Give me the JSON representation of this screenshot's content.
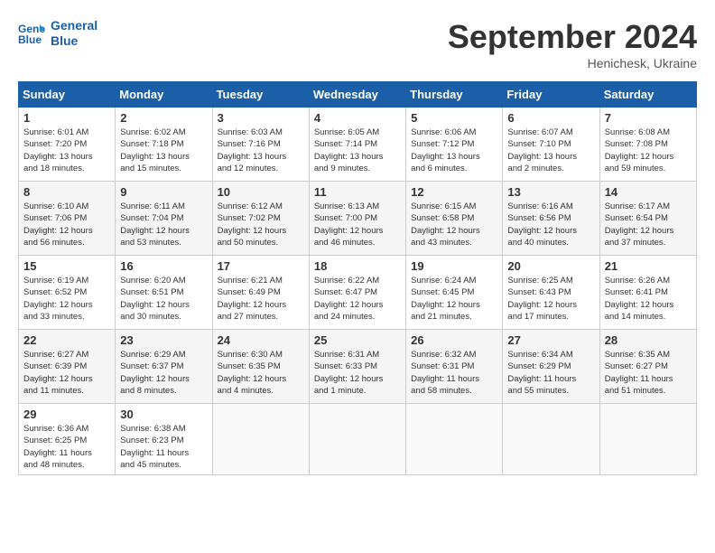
{
  "header": {
    "logo_line1": "General",
    "logo_line2": "Blue",
    "month": "September 2024",
    "location": "Henichesk, Ukraine"
  },
  "days_of_week": [
    "Sunday",
    "Monday",
    "Tuesday",
    "Wednesday",
    "Thursday",
    "Friday",
    "Saturday"
  ],
  "weeks": [
    [
      {
        "day": "1",
        "info": "Sunrise: 6:01 AM\nSunset: 7:20 PM\nDaylight: 13 hours\nand 18 minutes."
      },
      {
        "day": "2",
        "info": "Sunrise: 6:02 AM\nSunset: 7:18 PM\nDaylight: 13 hours\nand 15 minutes."
      },
      {
        "day": "3",
        "info": "Sunrise: 6:03 AM\nSunset: 7:16 PM\nDaylight: 13 hours\nand 12 minutes."
      },
      {
        "day": "4",
        "info": "Sunrise: 6:05 AM\nSunset: 7:14 PM\nDaylight: 13 hours\nand 9 minutes."
      },
      {
        "day": "5",
        "info": "Sunrise: 6:06 AM\nSunset: 7:12 PM\nDaylight: 13 hours\nand 6 minutes."
      },
      {
        "day": "6",
        "info": "Sunrise: 6:07 AM\nSunset: 7:10 PM\nDaylight: 13 hours\nand 2 minutes."
      },
      {
        "day": "7",
        "info": "Sunrise: 6:08 AM\nSunset: 7:08 PM\nDaylight: 12 hours\nand 59 minutes."
      }
    ],
    [
      {
        "day": "8",
        "info": "Sunrise: 6:10 AM\nSunset: 7:06 PM\nDaylight: 12 hours\nand 56 minutes."
      },
      {
        "day": "9",
        "info": "Sunrise: 6:11 AM\nSunset: 7:04 PM\nDaylight: 12 hours\nand 53 minutes."
      },
      {
        "day": "10",
        "info": "Sunrise: 6:12 AM\nSunset: 7:02 PM\nDaylight: 12 hours\nand 50 minutes."
      },
      {
        "day": "11",
        "info": "Sunrise: 6:13 AM\nSunset: 7:00 PM\nDaylight: 12 hours\nand 46 minutes."
      },
      {
        "day": "12",
        "info": "Sunrise: 6:15 AM\nSunset: 6:58 PM\nDaylight: 12 hours\nand 43 minutes."
      },
      {
        "day": "13",
        "info": "Sunrise: 6:16 AM\nSunset: 6:56 PM\nDaylight: 12 hours\nand 40 minutes."
      },
      {
        "day": "14",
        "info": "Sunrise: 6:17 AM\nSunset: 6:54 PM\nDaylight: 12 hours\nand 37 minutes."
      }
    ],
    [
      {
        "day": "15",
        "info": "Sunrise: 6:19 AM\nSunset: 6:52 PM\nDaylight: 12 hours\nand 33 minutes."
      },
      {
        "day": "16",
        "info": "Sunrise: 6:20 AM\nSunset: 6:51 PM\nDaylight: 12 hours\nand 30 minutes."
      },
      {
        "day": "17",
        "info": "Sunrise: 6:21 AM\nSunset: 6:49 PM\nDaylight: 12 hours\nand 27 minutes."
      },
      {
        "day": "18",
        "info": "Sunrise: 6:22 AM\nSunset: 6:47 PM\nDaylight: 12 hours\nand 24 minutes."
      },
      {
        "day": "19",
        "info": "Sunrise: 6:24 AM\nSunset: 6:45 PM\nDaylight: 12 hours\nand 21 minutes."
      },
      {
        "day": "20",
        "info": "Sunrise: 6:25 AM\nSunset: 6:43 PM\nDaylight: 12 hours\nand 17 minutes."
      },
      {
        "day": "21",
        "info": "Sunrise: 6:26 AM\nSunset: 6:41 PM\nDaylight: 12 hours\nand 14 minutes."
      }
    ],
    [
      {
        "day": "22",
        "info": "Sunrise: 6:27 AM\nSunset: 6:39 PM\nDaylight: 12 hours\nand 11 minutes."
      },
      {
        "day": "23",
        "info": "Sunrise: 6:29 AM\nSunset: 6:37 PM\nDaylight: 12 hours\nand 8 minutes."
      },
      {
        "day": "24",
        "info": "Sunrise: 6:30 AM\nSunset: 6:35 PM\nDaylight: 12 hours\nand 4 minutes."
      },
      {
        "day": "25",
        "info": "Sunrise: 6:31 AM\nSunset: 6:33 PM\nDaylight: 12 hours\nand 1 minute."
      },
      {
        "day": "26",
        "info": "Sunrise: 6:32 AM\nSunset: 6:31 PM\nDaylight: 11 hours\nand 58 minutes."
      },
      {
        "day": "27",
        "info": "Sunrise: 6:34 AM\nSunset: 6:29 PM\nDaylight: 11 hours\nand 55 minutes."
      },
      {
        "day": "28",
        "info": "Sunrise: 6:35 AM\nSunset: 6:27 PM\nDaylight: 11 hours\nand 51 minutes."
      }
    ],
    [
      {
        "day": "29",
        "info": "Sunrise: 6:36 AM\nSunset: 6:25 PM\nDaylight: 11 hours\nand 48 minutes."
      },
      {
        "day": "30",
        "info": "Sunrise: 6:38 AM\nSunset: 6:23 PM\nDaylight: 11 hours\nand 45 minutes."
      },
      {
        "day": "",
        "info": ""
      },
      {
        "day": "",
        "info": ""
      },
      {
        "day": "",
        "info": ""
      },
      {
        "day": "",
        "info": ""
      },
      {
        "day": "",
        "info": ""
      }
    ]
  ]
}
